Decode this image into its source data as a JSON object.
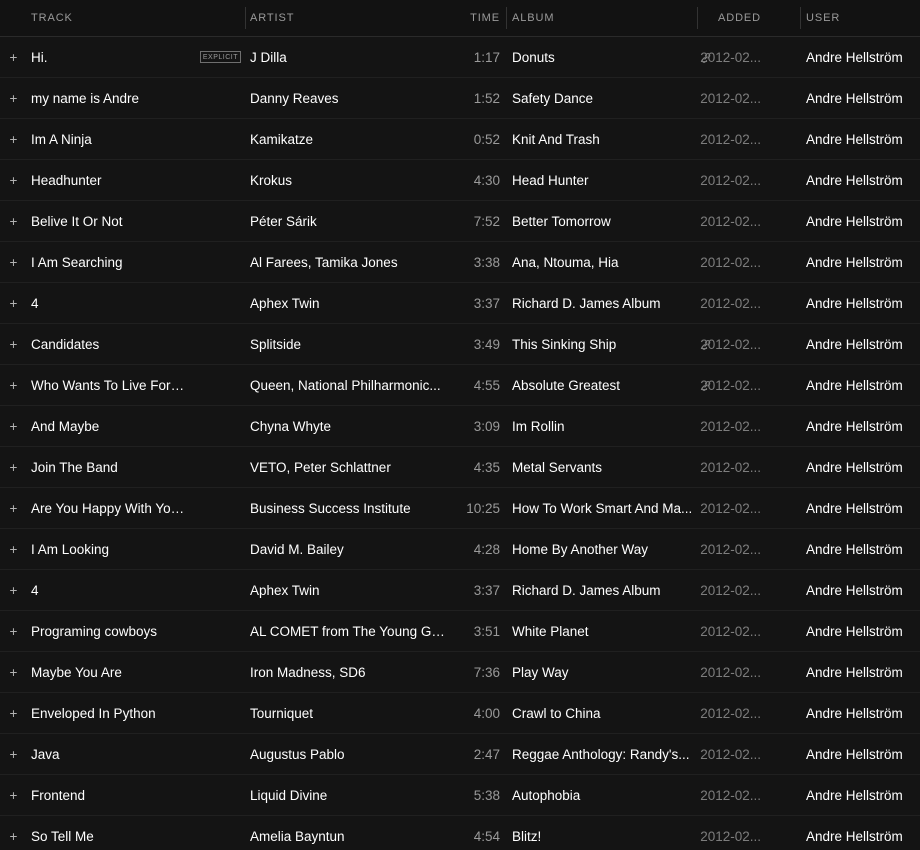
{
  "header": {
    "columns": [
      {
        "key": "track",
        "label": "TRACK"
      },
      {
        "key": "artist",
        "label": "ARTIST"
      },
      {
        "key": "time",
        "label": "TIME"
      },
      {
        "key": "album",
        "label": "ALBUM"
      },
      {
        "key": "added",
        "label": "ADDED"
      },
      {
        "key": "user",
        "label": "USER"
      }
    ]
  },
  "icons": {
    "add": "+",
    "link": "link-icon",
    "explicit_label": "EXPLICIT"
  },
  "colors": {
    "background": "#121212",
    "row_background": "#141414",
    "row_divider": "#202020",
    "header_text": "#9a9a9a",
    "primary_text": "#ffffff",
    "muted_text": "#7d7d7d",
    "column_divider": "#333333"
  },
  "tracks": [
    {
      "title": "Hi.",
      "explicit": true,
      "artist": "J Dilla",
      "time": "1:17",
      "album": "Donuts",
      "link": true,
      "added": "2012-02...",
      "user": "Andre Hellström"
    },
    {
      "title": "my name is Andre",
      "explicit": false,
      "artist": "Danny Reaves",
      "time": "1:52",
      "album": "Safety Dance",
      "link": false,
      "added": "2012-02...",
      "user": "Andre Hellström"
    },
    {
      "title": "Im A Ninja",
      "explicit": false,
      "artist": "Kamikatze",
      "time": "0:52",
      "album": "Knit And Trash",
      "link": false,
      "added": "2012-02...",
      "user": "Andre Hellström"
    },
    {
      "title": "Headhunter",
      "explicit": false,
      "artist": "Krokus",
      "time": "4:30",
      "album": "Head Hunter",
      "link": false,
      "added": "2012-02...",
      "user": "Andre Hellström"
    },
    {
      "title": "Belive It Or Not",
      "explicit": false,
      "artist": "Péter Sárik",
      "time": "7:52",
      "album": "Better Tomorrow",
      "link": false,
      "added": "2012-02...",
      "user": "Andre Hellström"
    },
    {
      "title": "I Am Searching",
      "explicit": false,
      "artist": "Al Farees, Tamika Jones",
      "time": "3:38",
      "album": "Ana, Ntouma, Hia",
      "link": false,
      "added": "2012-02...",
      "user": "Andre Hellström"
    },
    {
      "title": "4",
      "explicit": false,
      "artist": "Aphex Twin",
      "time": "3:37",
      "album": "Richard D. James Album",
      "link": false,
      "added": "2012-02...",
      "user": "Andre Hellström"
    },
    {
      "title": "Candidates",
      "explicit": false,
      "artist": "Splitside",
      "time": "3:49",
      "album": "This Sinking Ship",
      "link": true,
      "added": "2012-02...",
      "user": "Andre Hellström"
    },
    {
      "title": "Who Wants To Live Forever - Edit",
      "explicit": false,
      "artist": "Queen, National Philharmonic...",
      "time": "4:55",
      "album": "Absolute Greatest",
      "link": true,
      "added": "2012-02...",
      "user": "Andre Hellström"
    },
    {
      "title": "And Maybe",
      "explicit": false,
      "artist": "Chyna Whyte",
      "time": "3:09",
      "album": "Im Rollin",
      "link": false,
      "added": "2012-02...",
      "user": "Andre Hellström"
    },
    {
      "title": "Join The Band",
      "explicit": false,
      "artist": "VETO, Peter Schlattner",
      "time": "4:35",
      "album": "Metal Servants",
      "link": false,
      "added": "2012-02...",
      "user": "Andre Hellström"
    },
    {
      "title": "Are You Happy With Your Current...",
      "explicit": false,
      "artist": "Business Success Institute",
      "time": "10:25",
      "album": "How To Work Smart And Ma...",
      "link": false,
      "added": "2012-02...",
      "user": "Andre Hellström"
    },
    {
      "title": "I Am Looking",
      "explicit": false,
      "artist": "David M. Bailey",
      "time": "4:28",
      "album": "Home By Another Way",
      "link": false,
      "added": "2012-02...",
      "user": "Andre Hellström"
    },
    {
      "title": "4",
      "explicit": false,
      "artist": "Aphex Twin",
      "time": "3:37",
      "album": "Richard D. James Album",
      "link": false,
      "added": "2012-02...",
      "user": "Andre Hellström"
    },
    {
      "title": "Programing cowboys",
      "explicit": false,
      "artist": "AL COMET from The Young Go...",
      "time": "3:51",
      "album": "White Planet",
      "link": false,
      "added": "2012-02...",
      "user": "Andre Hellström"
    },
    {
      "title": "Maybe You Are",
      "explicit": false,
      "artist": "Iron Madness, SD6",
      "time": "7:36",
      "album": "Play Way",
      "link": false,
      "added": "2012-02...",
      "user": "Andre Hellström"
    },
    {
      "title": "Enveloped In Python",
      "explicit": false,
      "artist": "Tourniquet",
      "time": "4:00",
      "album": "Crawl to China",
      "link": false,
      "added": "2012-02...",
      "user": "Andre Hellström"
    },
    {
      "title": "Java",
      "explicit": false,
      "artist": "Augustus Pablo",
      "time": "2:47",
      "album": "Reggae Anthology: Randy's...",
      "link": false,
      "added": "2012-02...",
      "user": "Andre Hellström"
    },
    {
      "title": "Frontend",
      "explicit": false,
      "artist": "Liquid Divine",
      "time": "5:38",
      "album": "Autophobia",
      "link": false,
      "added": "2012-02...",
      "user": "Andre Hellström"
    },
    {
      "title": "So Tell Me",
      "explicit": false,
      "artist": "Amelia Bayntun",
      "time": "4:54",
      "album": "Blitz!",
      "link": false,
      "added": "2012-02...",
      "user": "Andre Hellström"
    }
  ]
}
